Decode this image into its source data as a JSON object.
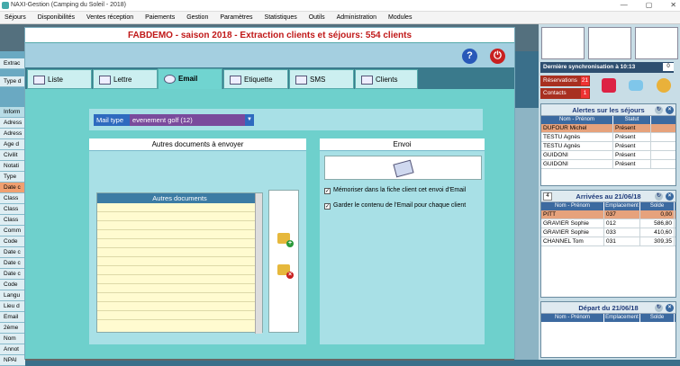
{
  "window": {
    "title": "NAXI-Gestion (Camping du Soleil - 2018)",
    "controls": [
      "—",
      "▢",
      "✕"
    ]
  },
  "menu": [
    "Séjours",
    "Disponibilités",
    "Ventes réception",
    "Paiements",
    "Gestion",
    "Paramètres",
    "Statistiques",
    "Outils",
    "Administration",
    "Modules"
  ],
  "left_fields": [
    "Extrac",
    "Type d",
    "Inform",
    "Adress",
    "Adress",
    "Age d",
    "Civilit",
    "Notati",
    "Type",
    "Date c",
    "Class",
    "Class",
    "Class",
    "Comm",
    "Code",
    "Date c",
    "Date c",
    "Date c",
    "Code",
    "Langu",
    "Lieu d",
    "Email",
    "2ème",
    "Nom",
    "Annot",
    "NPAI"
  ],
  "dialog": {
    "title": "FABDEMO - saison 2018 - Extraction clients et séjours: 554 clients",
    "help_icon": "?",
    "power_icon": "⏻",
    "tabs": [
      {
        "label": "Liste",
        "icon": "list-icon"
      },
      {
        "label": "Lettre",
        "icon": "letter-icon"
      },
      {
        "label": "Email",
        "icon": "email-icon"
      },
      {
        "label": "Etiquette",
        "icon": "label-icon"
      },
      {
        "label": "SMS",
        "icon": "sms-icon"
      },
      {
        "label": "Clients",
        "icon": "clients-icon"
      }
    ],
    "active_tab": "Email",
    "mail_type": {
      "label": "Mail type",
      "value": "evenement golf (12)"
    },
    "docs_panel": {
      "title": "Autres documents à envoyer",
      "list_header": "Autres documents"
    },
    "envoi_panel": {
      "title": "Envoi",
      "check1": "Mémoriser dans la fiche client cet envoi d'Email",
      "check2": "Garder le contenu de l'Email pour chaque client"
    }
  },
  "right_panel": {
    "sync": "Dernière synchronisation à 10:13",
    "sync_count": "0",
    "reservations": {
      "label": "Réservations",
      "count": "21"
    },
    "contacts": {
      "label": "Contacts",
      "count": "1"
    },
    "alertes": {
      "title": "Alertes sur les séjours",
      "columns": [
        "Nom - Prénom",
        "Statut"
      ],
      "rows": [
        {
          "name": "DUFOUR Michel",
          "status": "Présent"
        },
        {
          "name": "TESTU Agnès",
          "status": "Présent"
        },
        {
          "name": "TESTU Agnès",
          "status": "Présent"
        },
        {
          "name": "GUIDONI",
          "status": "Présent"
        },
        {
          "name": "GUIDONI",
          "status": "Présent"
        }
      ]
    },
    "arrivees": {
      "count": "4",
      "title": "Arrivées au 21/06/18",
      "columns": [
        "Nom - Prénom",
        "Emplacement",
        "Solde"
      ],
      "rows": [
        {
          "name": "PITT",
          "place": "037",
          "solde": "0,00"
        },
        {
          "name": "GRAVIER Sophie",
          "place": "012",
          "solde": "586,80"
        },
        {
          "name": "GRAVIER Sophie",
          "place": "033",
          "solde": "410,60"
        },
        {
          "name": "CHANNEL Tom",
          "place": "031",
          "solde": "309,35"
        }
      ]
    },
    "departs": {
      "title": "Départ du 21/06/18",
      "columns": [
        "Nom - Prénom",
        "Emplacement",
        "Solde"
      ]
    }
  }
}
